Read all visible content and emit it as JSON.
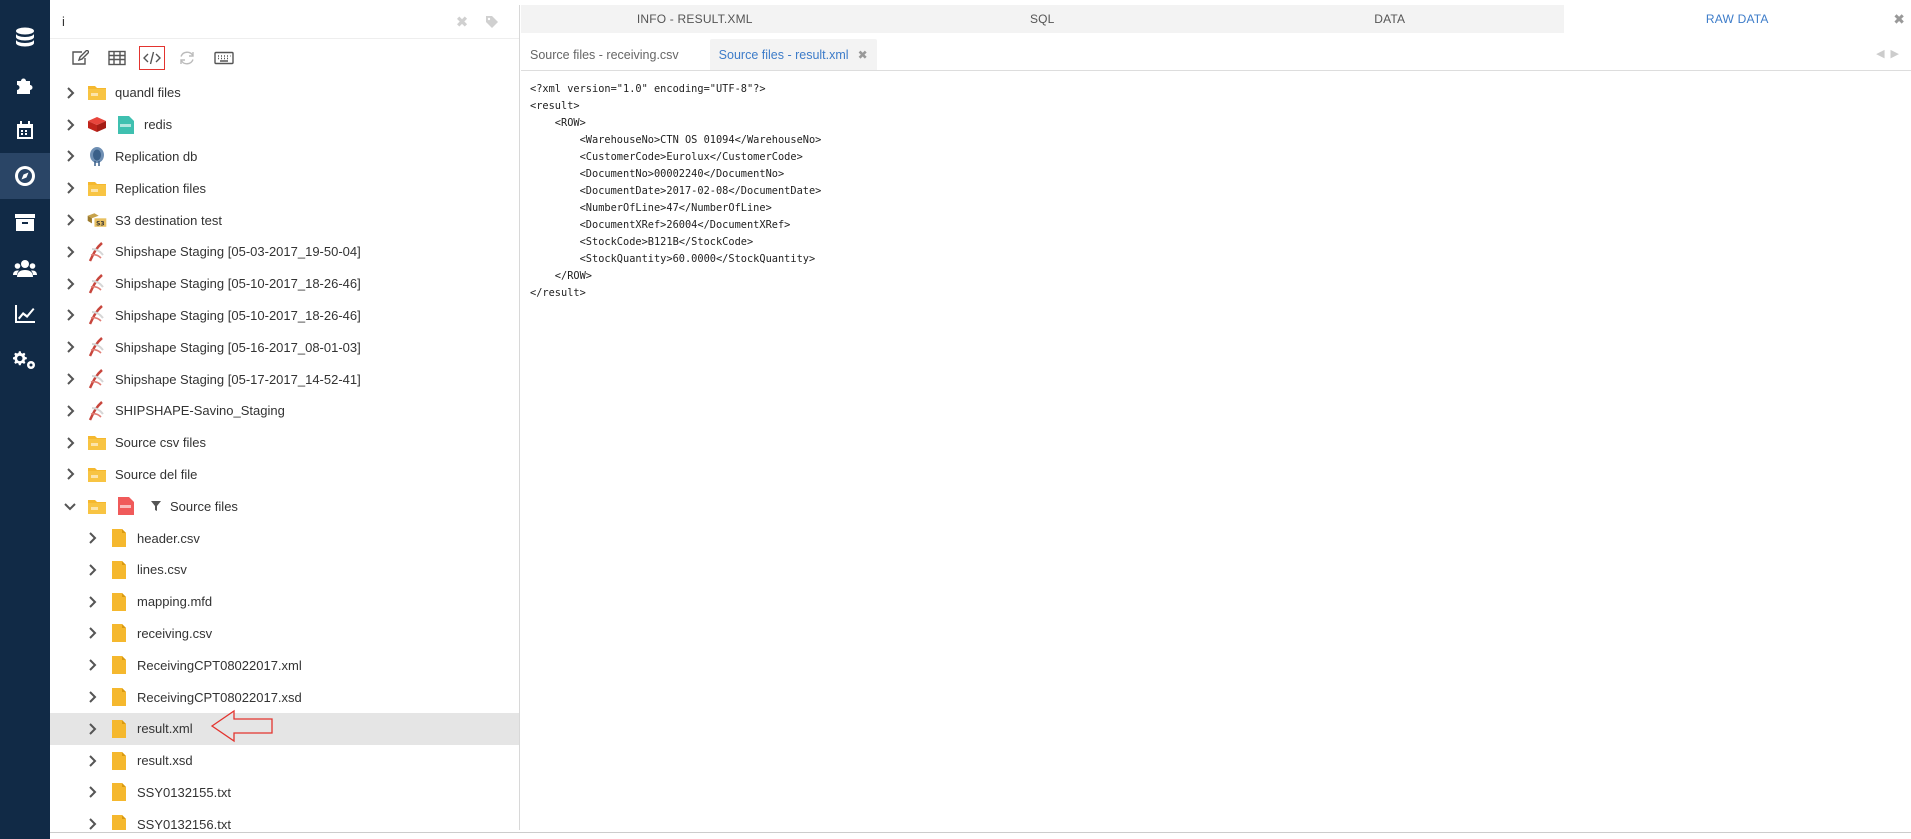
{
  "search": {
    "value": "i"
  },
  "tree": {
    "items": [
      {
        "label": "quandl files",
        "icon": "folder-icon",
        "level": 0,
        "expanded": false
      },
      {
        "label": "redis",
        "icon": "redis-icon",
        "level": 0,
        "expanded": false
      },
      {
        "label": "Replication db",
        "icon": "postgres-icon",
        "level": 0,
        "expanded": false
      },
      {
        "label": "Replication files",
        "icon": "folder-icon",
        "level": 0,
        "expanded": false
      },
      {
        "label": "S3 destination test",
        "icon": "s3-icon",
        "level": 0,
        "expanded": false
      },
      {
        "label": "Shipshape Staging [05-03-2017_19-50-04]",
        "icon": "sqlserver-icon",
        "level": 0,
        "expanded": false
      },
      {
        "label": "Shipshape Staging [05-10-2017_18-26-46]",
        "icon": "sqlserver-icon",
        "level": 0,
        "expanded": false
      },
      {
        "label": "Shipshape Staging [05-10-2017_18-26-46]",
        "icon": "sqlserver-icon",
        "level": 0,
        "expanded": false
      },
      {
        "label": "Shipshape Staging [05-16-2017_08-01-03]",
        "icon": "sqlserver-icon",
        "level": 0,
        "expanded": false
      },
      {
        "label": "Shipshape Staging [05-17-2017_14-52-41]",
        "icon": "sqlserver-icon",
        "level": 0,
        "expanded": false
      },
      {
        "label": "SHIPSHAPE-Savino_Staging",
        "icon": "sqlserver-icon",
        "level": 0,
        "expanded": false
      },
      {
        "label": "Source csv files",
        "icon": "folder-icon",
        "level": 0,
        "expanded": false
      },
      {
        "label": "Source del file",
        "icon": "folder-icon",
        "level": 0,
        "expanded": false
      },
      {
        "label": "Source files",
        "icon": "folder-icon",
        "level": 0,
        "expanded": true
      },
      {
        "label": "header.csv",
        "icon": "file-icon",
        "level": 1,
        "expanded": false
      },
      {
        "label": "lines.csv",
        "icon": "file-icon",
        "level": 1,
        "expanded": false
      },
      {
        "label": "mapping.mfd",
        "icon": "file-icon",
        "level": 1,
        "expanded": false
      },
      {
        "label": "receiving.csv",
        "icon": "file-icon",
        "level": 1,
        "expanded": false
      },
      {
        "label": "ReceivingCPT08022017.xml",
        "icon": "file-icon",
        "level": 1,
        "expanded": false
      },
      {
        "label": "ReceivingCPT08022017.xsd",
        "icon": "file-icon",
        "level": 1,
        "expanded": false
      },
      {
        "label": "result.xml",
        "icon": "file-icon",
        "level": 1,
        "expanded": false,
        "highlighted": true
      },
      {
        "label": "result.xsd",
        "icon": "file-icon",
        "level": 1,
        "expanded": false
      },
      {
        "label": "SSY0132155.txt",
        "icon": "file-icon",
        "level": 1,
        "expanded": false
      },
      {
        "label": "SSY0132156.txt",
        "icon": "file-icon",
        "level": 1,
        "expanded": false
      }
    ]
  },
  "main_tabs": [
    "INFO - RESULT.XML",
    "SQL",
    "DATA",
    "RAW DATA"
  ],
  "main_tabs_active": 3,
  "sub_tabs": [
    "Source files - receiving.csv",
    "Source files - result.xml"
  ],
  "sub_tabs_active": 1,
  "code": "<?xml version=\"1.0\" encoding=\"UTF-8\"?>\n<result>\n    <ROW>\n        <WarehouseNo>CTN OS 01094</WarehouseNo>\n        <CustomerCode>Eurolux</CustomerCode>\n        <DocumentNo>00002240</DocumentNo>\n        <DocumentDate>2017-02-08</DocumentDate>\n        <NumberOfLine>47</NumberOfLine>\n        <DocumentXRef>26004</DocumentXRef>\n        <StockCode>B121B</StockCode>\n        <StockQuantity>60.0000</StockQuantity>\n    </ROW>\n</result>",
  "colors": {
    "nav_bg": "#112a46",
    "accent": "#3d7cc9",
    "folder": "#f5b82e",
    "highlight_border": "#e3342f"
  }
}
